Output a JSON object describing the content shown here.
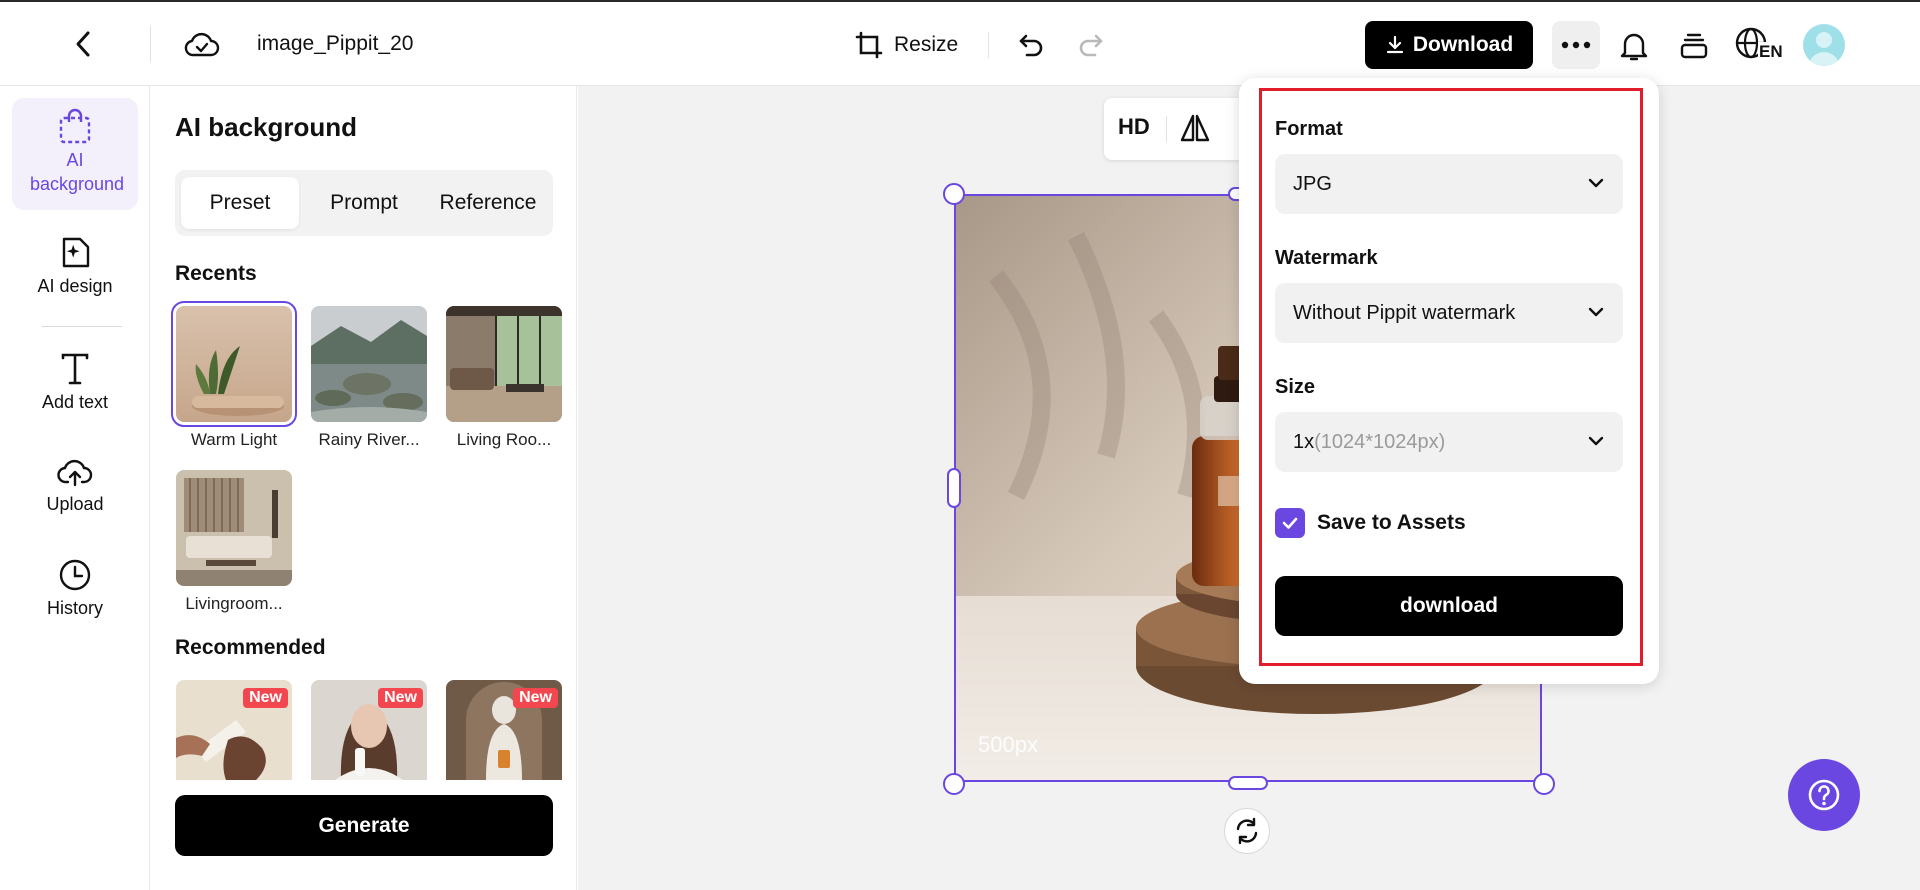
{
  "header": {
    "filename": "image_Pippit_20",
    "resize_label": "Resize",
    "download_label": "Download",
    "language_code": "EN"
  },
  "rail": {
    "items": [
      {
        "label": "AI background",
        "icon": "shopping-bag-icon",
        "active": true
      },
      {
        "label": "AI design",
        "icon": "sparkle-image-icon"
      },
      {
        "label": "Add text",
        "icon": "text-icon"
      },
      {
        "label": "Upload",
        "icon": "cloud-upload-icon"
      },
      {
        "label": "History",
        "icon": "clock-icon"
      }
    ]
  },
  "panel": {
    "title": "AI background",
    "tabs": [
      "Preset",
      "Prompt",
      "Reference"
    ],
    "active_tab": "Preset",
    "recents_title": "Recents",
    "recents": [
      {
        "label": "Warm Light",
        "selected": true
      },
      {
        "label": "Rainy River..."
      },
      {
        "label": "Living Roo..."
      },
      {
        "label": "Livingroom..."
      }
    ],
    "recommended_title": "Recommended",
    "recommended_badge": "New",
    "generate_label": "Generate"
  },
  "canvas": {
    "hd_label": "HD",
    "watermark_text": "500px"
  },
  "download_popover": {
    "format_label": "Format",
    "format_value": "JPG",
    "watermark_label": "Watermark",
    "watermark_value": "Without Pippit watermark",
    "size_label": "Size",
    "size_value": "1x",
    "size_detail": "(1024*1024px)",
    "save_to_assets_label": "Save to Assets",
    "save_to_assets_checked": true,
    "download_button": "download"
  },
  "colors": {
    "accent": "#6a47e0",
    "highlight": "#e11d2b",
    "badge": "#f2474f"
  }
}
